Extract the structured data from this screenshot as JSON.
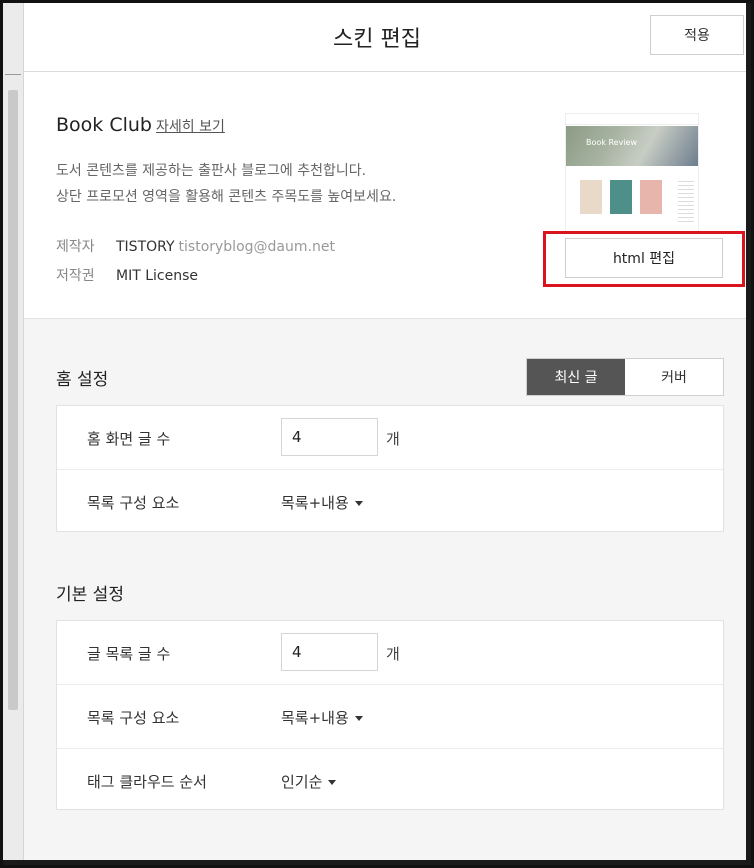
{
  "header": {
    "title": "스킨 편집",
    "apply_label": "적용"
  },
  "skin": {
    "name": "Book Club",
    "detail_link": "자세히 보기",
    "description_lines": [
      "도서 콘텐츠를 제공하는 출판사 블로그에 추천합니다.",
      "상단 프로모션 영역을 활용해 콘텐츠 주목도를 높여보세요."
    ],
    "maker_label": "제작자",
    "maker_name": "TISTORY",
    "maker_email": "tistoryblog@daum.net",
    "license_label": "저작권",
    "license_value": "MIT License",
    "thumbnail_caption": "Book Review",
    "html_edit_label": "html 편집"
  },
  "home_settings": {
    "title": "홈 설정",
    "toggle": [
      {
        "label": "최신 글",
        "active": true
      },
      {
        "label": "커버",
        "active": false
      }
    ],
    "post_count_label": "홈 화면 글 수",
    "post_count_value": "4",
    "unit": "개",
    "list_component_label": "목록 구성 요소",
    "list_component_value": "목록+내용"
  },
  "basic_settings": {
    "title": "기본 설정",
    "post_count_label": "글 목록 글 수",
    "post_count_value": "4",
    "unit": "개",
    "list_component_label": "목록 구성 요소",
    "list_component_value": "목록+내용",
    "tag_cloud_label": "태그 클라우드 순서",
    "tag_cloud_value": "인기순"
  },
  "colors": {
    "highlight_border": "#d9141f",
    "toggle_active_bg": "#555555"
  }
}
